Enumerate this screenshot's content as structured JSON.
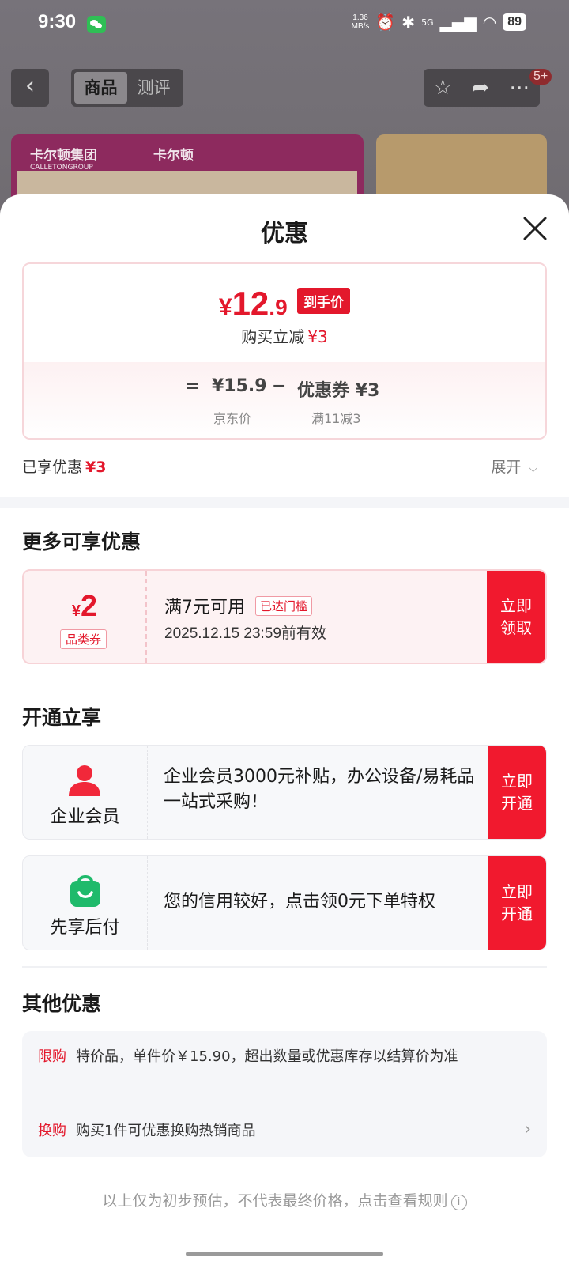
{
  "status_bar": {
    "time": "9:30",
    "net_speed_value": "1.36",
    "net_speed_unit": "MB/s",
    "network": "5G",
    "battery": "89"
  },
  "nav": {
    "back_icon": "chevron-left-icon",
    "tabs": [
      "商品",
      "测评"
    ],
    "active_tab": "商品",
    "badge": "5+"
  },
  "banner": {
    "brand": "卡尔顿集团",
    "brand_en": "CALLETONGROUP",
    "brand2": "卡尔顿"
  },
  "sheet": {
    "title": "优惠",
    "price": {
      "yen": "¥",
      "int": "12",
      "dec": ".9",
      "tag": "到手价",
      "reduce_label": "购买立减",
      "reduce_value": "¥3"
    },
    "formula": {
      "eq": "=",
      "base": "¥15.9",
      "minus": "−",
      "coupon": "优惠券 ¥3",
      "base_label": "京东价",
      "coupon_label": "满11减3"
    },
    "enjoyed_label": "已享优惠",
    "enjoyed_value": "¥3",
    "expand_label": "展开"
  },
  "more": {
    "title": "更多可享优惠",
    "coupon": {
      "yen": "¥",
      "amount": "2",
      "type": "品类券",
      "condition": "满7元可用",
      "threshold_tag": "已达门槛",
      "expiry": "2025.12.15 23:59前有效",
      "cta": "立即领取"
    }
  },
  "open": {
    "title": "开通立享",
    "items": [
      {
        "name": "企业会员",
        "desc": "企业会员3000元补贴，办公设备/易耗品一站式采购！",
        "cta": "立即开通",
        "icon": "person-icon"
      },
      {
        "name": "先享后付",
        "desc": "您的信用较好，点击领0元下单特权",
        "cta": "立即开通",
        "icon": "shopping-bag-icon"
      }
    ]
  },
  "other": {
    "title": "其他优惠",
    "items": [
      {
        "label": "限购",
        "text": "特价品，单件价￥15.90，超出数量或优惠库存以结算价为准"
      },
      {
        "label": "换购",
        "text": "购买1件可优惠换购热销商品"
      }
    ]
  },
  "footnote": "以上仅为初步预估，不代表最终价格，点击查看规则",
  "colors": {
    "accent": "#e3182c",
    "cta": "#f1192e"
  }
}
